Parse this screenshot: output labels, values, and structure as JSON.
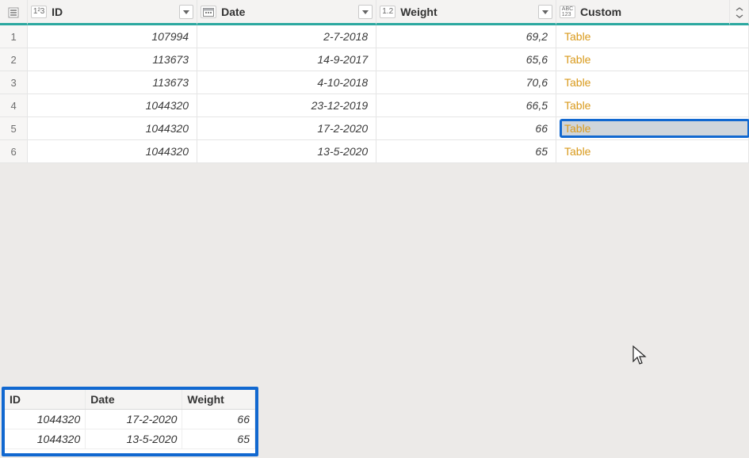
{
  "main": {
    "columns": {
      "id": {
        "label": "ID",
        "type_icon": "1²3"
      },
      "date": {
        "label": "Date",
        "type_icon": "calendar"
      },
      "weight": {
        "label": "Weight",
        "type_icon": "1.2"
      },
      "custom": {
        "label": "Custom",
        "type_icon": "ABC123"
      }
    },
    "rows": [
      {
        "n": "1",
        "id": "107994",
        "date": "2-7-2018",
        "weight": "69,2",
        "custom": "Table"
      },
      {
        "n": "2",
        "id": "113673",
        "date": "14-9-2017",
        "weight": "65,6",
        "custom": "Table"
      },
      {
        "n": "3",
        "id": "113673",
        "date": "4-10-2018",
        "weight": "70,6",
        "custom": "Table"
      },
      {
        "n": "4",
        "id": "1044320",
        "date": "23-12-2019",
        "weight": "66,5",
        "custom": "Table"
      },
      {
        "n": "5",
        "id": "1044320",
        "date": "17-2-2020",
        "weight": "66",
        "custom": "Table"
      },
      {
        "n": "6",
        "id": "1044320",
        "date": "13-5-2020",
        "weight": "65",
        "custom": "Table"
      }
    ],
    "selected_row_index": 4
  },
  "preview": {
    "columns": {
      "id": "ID",
      "date": "Date",
      "weight": "Weight"
    },
    "rows": [
      {
        "id": "1044320",
        "date": "17-2-2020",
        "weight": "66"
      },
      {
        "id": "1044320",
        "date": "13-5-2020",
        "weight": "65"
      }
    ]
  },
  "colors": {
    "accent": "#2ba8a0",
    "select": "#1168d0",
    "link": "#d99a1c"
  }
}
